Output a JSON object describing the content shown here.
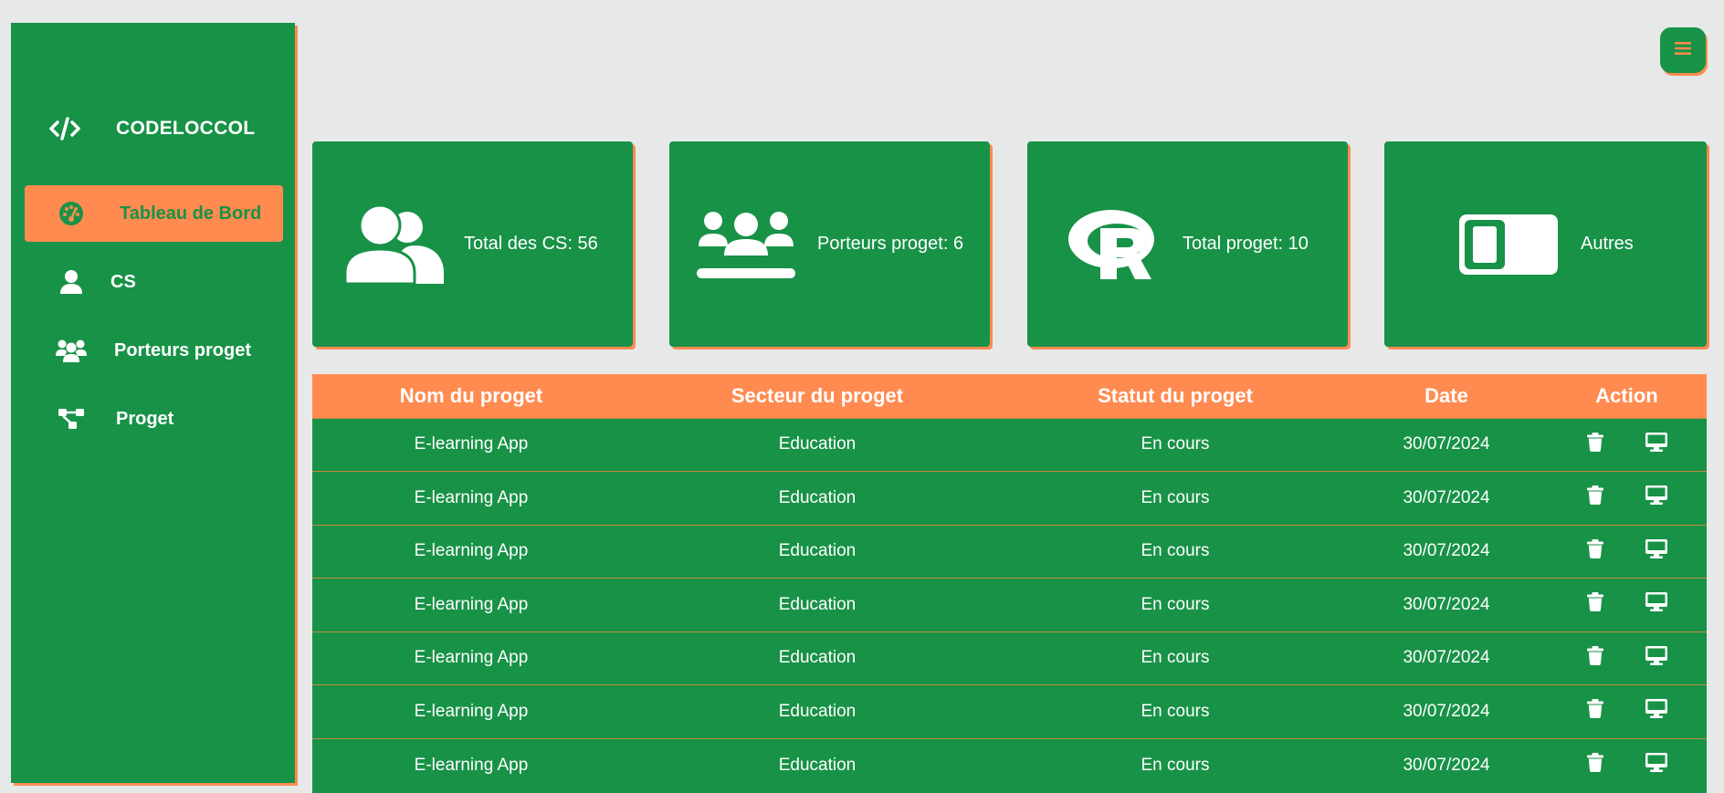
{
  "brand": {
    "name": "CODELOCCOL",
    "icon": "code-icon"
  },
  "sidebar": {
    "items": [
      {
        "label": "Tableau de Bord",
        "icon": "dashboard-icon",
        "active": true
      },
      {
        "label": "CS",
        "icon": "user-icon",
        "active": false
      },
      {
        "label": "Porteurs proget",
        "icon": "users-icon",
        "active": false
      },
      {
        "label": "Proget",
        "icon": "project-diagram-icon",
        "active": false
      }
    ]
  },
  "header": {
    "menu_icon": "menu-icon"
  },
  "cards": [
    {
      "label": "Total des CS: 56",
      "icon": "user-group-icon"
    },
    {
      "label": "Porteurs proget: 6",
      "icon": "people-roof-icon"
    },
    {
      "label": "Total proget: 10",
      "icon": "r-project-icon"
    },
    {
      "label": "Autres",
      "icon": "toggle-icon"
    }
  ],
  "table": {
    "headers": [
      "Nom du proget",
      "Secteur du proget",
      "Statut du proget",
      "Date",
      "Action"
    ],
    "rows": [
      {
        "nom": "E-learning App",
        "secteur": "Education",
        "statut": "En cours",
        "date": "30/07/2024"
      },
      {
        "nom": "E-learning App",
        "secteur": "Education",
        "statut": "En cours",
        "date": "30/07/2024"
      },
      {
        "nom": "E-learning App",
        "secteur": "Education",
        "statut": "En cours",
        "date": "30/07/2024"
      },
      {
        "nom": "E-learning App",
        "secteur": "Education",
        "statut": "En cours",
        "date": "30/07/2024"
      },
      {
        "nom": "E-learning App",
        "secteur": "Education",
        "statut": "En cours",
        "date": "30/07/2024"
      },
      {
        "nom": "E-learning App",
        "secteur": "Education",
        "statut": "En cours",
        "date": "30/07/2024"
      },
      {
        "nom": "E-learning App",
        "secteur": "Education",
        "statut": "En cours",
        "date": "30/07/2024"
      }
    ],
    "action_icons": [
      "trash-icon",
      "desktop-icon"
    ]
  },
  "colors": {
    "primary_green": "#189247",
    "accent_orange": "#ff8b51",
    "background": "#e7e8e8",
    "text_light": "#ffffff"
  }
}
